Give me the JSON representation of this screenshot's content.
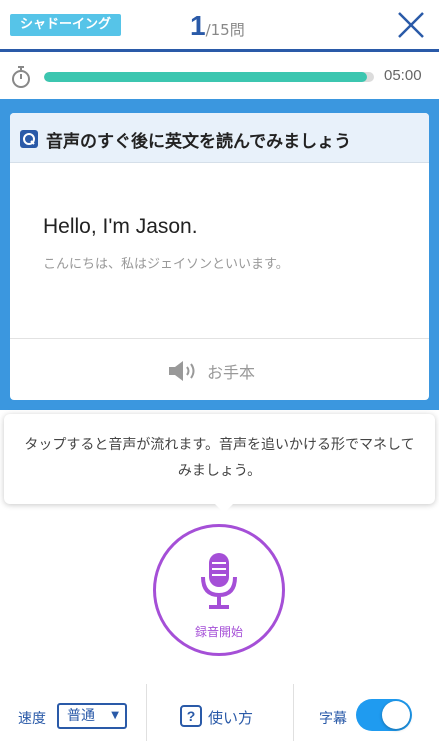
{
  "header": {
    "mode_badge": "シャドーイング",
    "current": "1",
    "total_text": "/15問"
  },
  "progress": {
    "fraction": 0.98,
    "timer": "05:00"
  },
  "card": {
    "title": "音声のすぐ後に英文を読んでみましょう",
    "english": "Hello, I'm Jason.",
    "japanese": "こんにちは、私はジェイソンといいます。",
    "model_label": "お手本"
  },
  "tooltip": {
    "text": "タップすると音声が流れます。音声を追いかける形でマネしてみましょう。"
  },
  "record": {
    "label": "録音開始"
  },
  "bottom": {
    "speed_label": "速度",
    "speed_value": "普通",
    "help_label": "使い方",
    "subtitle_label": "字幕",
    "subtitle_on": true
  },
  "colors": {
    "brand_blue": "#2a5aa8",
    "area_blue": "#3b97df",
    "progress_teal": "#3cc6b0",
    "record_purple": "#a54fd7",
    "badge_cyan": "#56c4e8",
    "toggle_blue": "#1f9bf0"
  },
  "icons": [
    "close-icon",
    "stopwatch-icon",
    "question-mark-icon",
    "speaker-icon",
    "microphone-icon",
    "dropdown-arrow-icon",
    "help-icon"
  ]
}
